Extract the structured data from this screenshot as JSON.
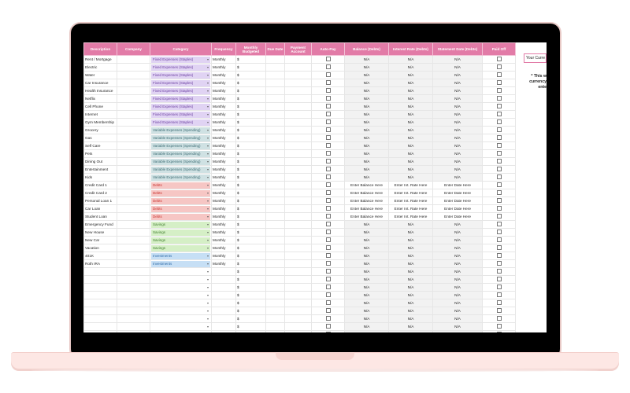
{
  "headers": [
    "Description",
    "Company",
    "Category",
    "Frequency",
    "Monthly Budgeted",
    "Due Date",
    "Payment Account",
    "Auto-Pay",
    "Balance (Debts)",
    "Interest Rate (Debts)",
    "Statement Date (Debts)",
    "Paid Off"
  ],
  "currency_symbol": "$",
  "frequency_value": "Monthly",
  "na_value": "N/A",
  "rows": [
    {
      "description": "Rent / Mortgage",
      "category": "Fixed Expenses (Staples)",
      "cat_type": "fixed"
    },
    {
      "description": "Electric",
      "category": "Fixed Expenses (Staples)",
      "cat_type": "fixed"
    },
    {
      "description": "Water",
      "category": "Fixed Expenses (Staples)",
      "cat_type": "fixed"
    },
    {
      "description": "Car Insurance",
      "category": "Fixed Expenses (Staples)",
      "cat_type": "fixed"
    },
    {
      "description": "Health Insurance",
      "category": "Fixed Expenses (Staples)",
      "cat_type": "fixed"
    },
    {
      "description": "Netflix",
      "category": "Fixed Expenses (Staples)",
      "cat_type": "fixed"
    },
    {
      "description": "Cell Phone",
      "category": "Fixed Expenses (Staples)",
      "cat_type": "fixed"
    },
    {
      "description": "Internet",
      "category": "Fixed Expenses (Staples)",
      "cat_type": "fixed"
    },
    {
      "description": "Gym Membership",
      "category": "Fixed Expenses (Staples)",
      "cat_type": "fixed"
    },
    {
      "description": "Grocery",
      "category": "Variable Expenses (Spending)",
      "cat_type": "variable"
    },
    {
      "description": "Gas",
      "category": "Variable Expenses (Spending)",
      "cat_type": "variable"
    },
    {
      "description": "Self Care",
      "category": "Variable Expenses (Spending)",
      "cat_type": "variable"
    },
    {
      "description": "Pets",
      "category": "Variable Expenses (Spending)",
      "cat_type": "variable"
    },
    {
      "description": "Dining Out",
      "category": "Variable Expenses (Spending)",
      "cat_type": "variable"
    },
    {
      "description": "Entertainment",
      "category": "Variable Expenses (Spending)",
      "cat_type": "variable"
    },
    {
      "description": "Kids",
      "category": "Variable Expenses (Spending)",
      "cat_type": "variable"
    },
    {
      "description": "Credit Card 1",
      "category": "Debts",
      "cat_type": "debts"
    },
    {
      "description": "Credit Card 2",
      "category": "Debts",
      "cat_type": "debts"
    },
    {
      "description": "Personal Loan 1",
      "category": "Debts",
      "cat_type": "debts"
    },
    {
      "description": "Car Loan",
      "category": "Debts",
      "cat_type": "debts"
    },
    {
      "description": "Student Loan",
      "category": "Debts",
      "cat_type": "debts"
    },
    {
      "description": "Emergency Fund",
      "category": "Savings",
      "cat_type": "savings"
    },
    {
      "description": "New House",
      "category": "Savings",
      "cat_type": "savings"
    },
    {
      "description": "New Car",
      "category": "Savings",
      "cat_type": "savings"
    },
    {
      "description": "Vacation",
      "category": "Savings",
      "cat_type": "savings"
    },
    {
      "description": "401K",
      "category": "Investments",
      "cat_type": "investments"
    },
    {
      "description": "Roth IRA",
      "category": "Investments",
      "cat_type": "investments"
    },
    {
      "description": "",
      "category": "",
      "cat_type": "empty"
    },
    {
      "description": "",
      "category": "",
      "cat_type": "empty"
    },
    {
      "description": "",
      "category": "",
      "cat_type": "empty"
    },
    {
      "description": "",
      "category": "",
      "cat_type": "empty"
    },
    {
      "description": "",
      "category": "",
      "cat_type": "empty"
    },
    {
      "description": "",
      "category": "",
      "cat_type": "empty"
    },
    {
      "description": "",
      "category": "",
      "cat_type": "empty"
    },
    {
      "description": "",
      "category": "",
      "cat_type": "empty"
    },
    {
      "description": "",
      "category": "",
      "cat_type": "empty"
    },
    {
      "description": "",
      "category": "",
      "cat_type": "empty"
    },
    {
      "description": "",
      "category": "",
      "cat_type": "empty"
    },
    {
      "description": "",
      "category": "",
      "cat_type": "empty"
    }
  ],
  "debt_placeholders": {
    "balance": "Enter Balance Here",
    "interest": "Enter Int. Rate Here",
    "statement": "Enter Date Here"
  },
  "side_panel": {
    "box_text": "Your Curre",
    "note_lines": [
      "* This w",
      "currency",
      "ente"
    ]
  },
  "colors": {
    "header_pink": "#e27ba7",
    "laptop_frame": "#000000",
    "laptop_base": "#fde7e4"
  }
}
